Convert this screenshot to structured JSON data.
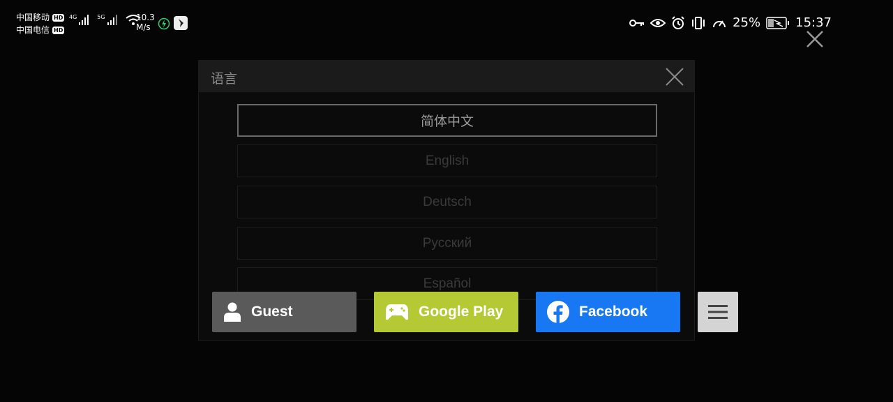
{
  "status_bar": {
    "carrier1": "中国移动",
    "carrier2": "中国电信",
    "hd": "HD",
    "net1": "4G",
    "net2": "5G",
    "speed_value": "10.3",
    "speed_unit": "M/s",
    "battery": "25%",
    "time": "15:37"
  },
  "dialog": {
    "title": "语言",
    "languages": [
      {
        "label": "简体中文",
        "selected": true
      },
      {
        "label": "English",
        "selected": false
      },
      {
        "label": "Deutsch",
        "selected": false
      },
      {
        "label": "Русский",
        "selected": false
      },
      {
        "label": "Español",
        "selected": false
      }
    ]
  },
  "login": {
    "guest": {
      "label": "Guest",
      "color": "#5a5a5a",
      "icon": "user-icon"
    },
    "google": {
      "label": "Google Play",
      "color": "#b5c935",
      "icon": "gamepad-icon"
    },
    "facebook": {
      "label": "Facebook",
      "color": "#1877f2",
      "icon": "facebook-icon"
    },
    "menu": {
      "color": "#d4d4d4",
      "icon": "hamburger-icon"
    }
  }
}
